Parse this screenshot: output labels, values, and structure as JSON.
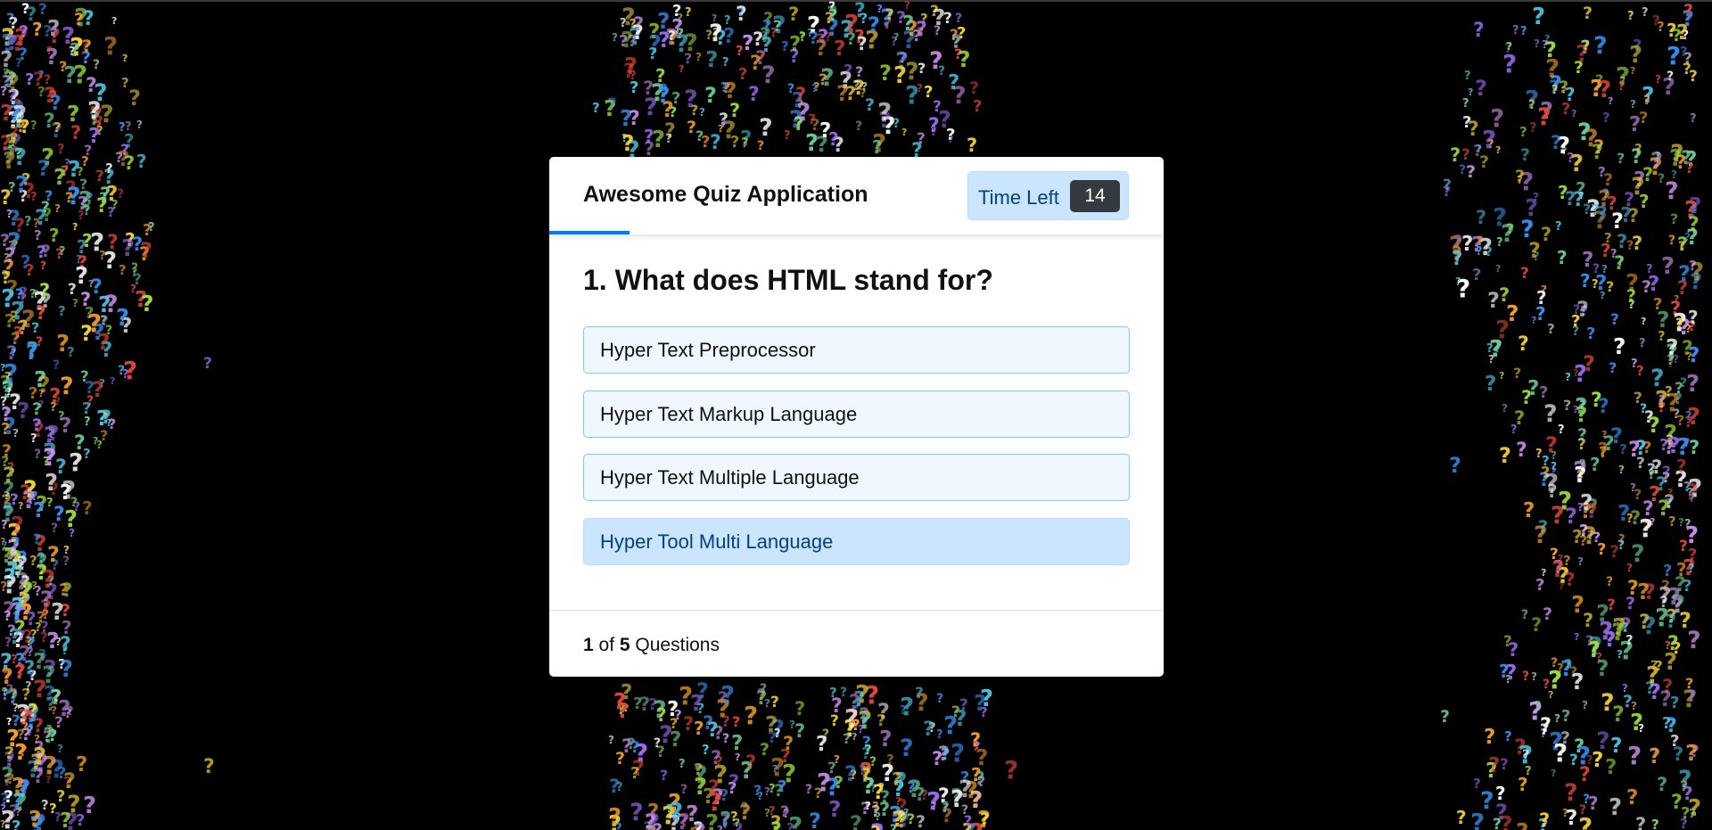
{
  "background": {
    "pattern_glyph": "?",
    "glyph_colors": [
      "#e0483a",
      "#f0a030",
      "#f2d13b",
      "#9fdc42",
      "#4fc2e0",
      "#3a8ff0",
      "#9b6cf0",
      "#c98fe8",
      "#ffffff",
      "#6fcf97"
    ]
  },
  "quiz": {
    "title": "Awesome Quiz Application",
    "timer": {
      "label": "Time Left",
      "seconds": "14"
    },
    "time_progress": 0.13,
    "question": "1. What does HTML stand for?",
    "options": [
      "Hyper Text Preprocessor",
      "Hyper Text Markup Language",
      "Hyper Text Multiple Language",
      "Hyper Tool Multi Language"
    ],
    "footer": {
      "current": "1",
      "of_text": "of",
      "total": "5",
      "suffix": "Questions"
    }
  },
  "colors": {
    "accent": "#007bff",
    "timer_bg": "#cce5ff",
    "timer_text": "#004085",
    "timer_badge": "#343a40",
    "option_bg": "#f0f8ff",
    "option_border": "#84c5fe"
  }
}
